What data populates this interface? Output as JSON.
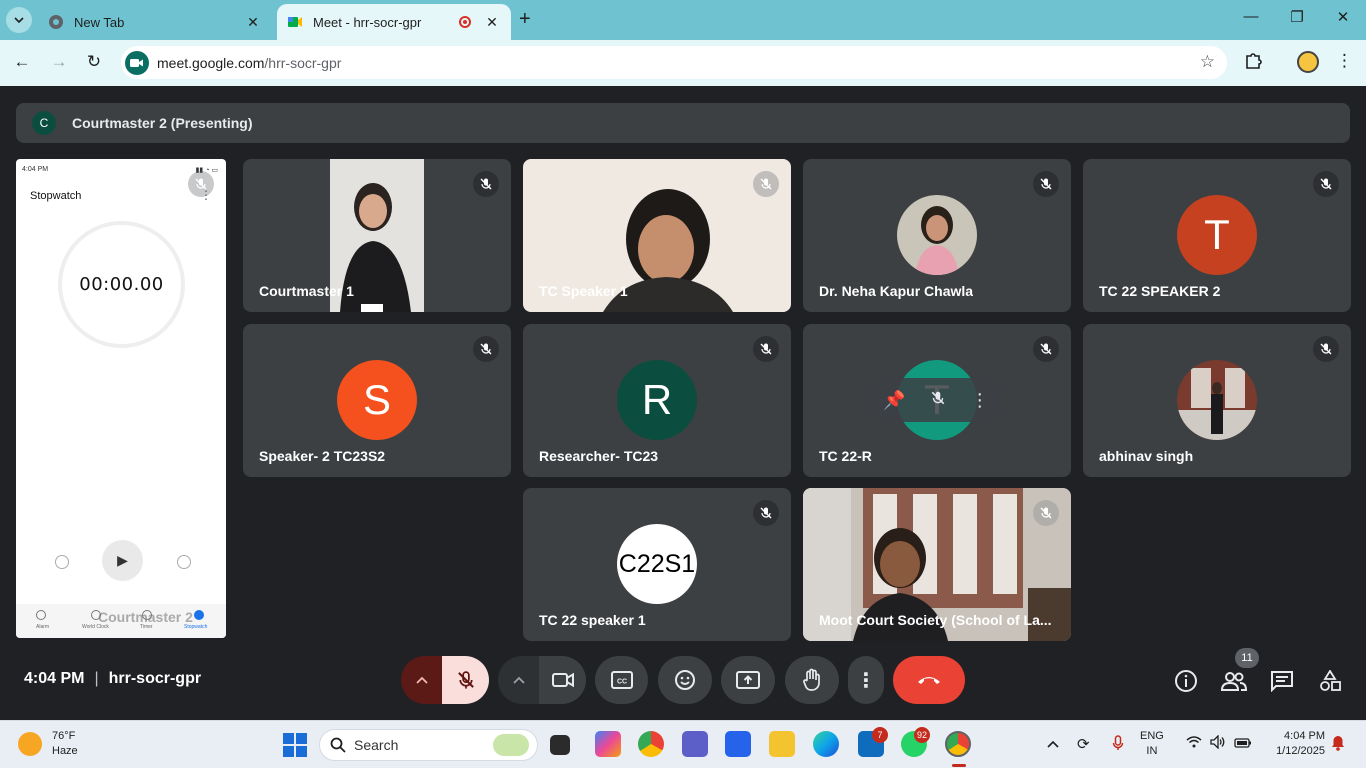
{
  "browser": {
    "tabs": [
      {
        "title": "New Tab",
        "active": false
      },
      {
        "title": "Meet - hrr-socr-gpr",
        "active": true,
        "recording": true
      }
    ],
    "url_domain": "meet.google.com",
    "url_path": "/hrr-socr-gpr"
  },
  "meet": {
    "presenting": {
      "avatar_letter": "C",
      "label": "Courtmaster 2 (Presenting)"
    },
    "shared_screen": {
      "status_time": "4:04 PM",
      "app_title": "Stopwatch",
      "timer": "00:00.00",
      "nav_items": [
        "Alarm",
        "World Clock",
        "Timer",
        "Stopwatch"
      ],
      "overlay_name": "Courtmaster 2"
    },
    "participants": [
      {
        "name": "Courtmaster 1",
        "type": "video"
      },
      {
        "name": "TC Speaker 1",
        "type": "video"
      },
      {
        "name": "Dr. Neha Kapur Chawla",
        "type": "photo"
      },
      {
        "name": "TC 22 SPEAKER 2",
        "type": "letter",
        "letter": "T",
        "color": "#c5411f"
      },
      {
        "name": "Speaker- 2 TC23S2",
        "type": "letter",
        "letter": "S",
        "color": "#f4511e"
      },
      {
        "name": "Researcher- TC23",
        "type": "letter",
        "letter": "R",
        "color": "#0b4d3e"
      },
      {
        "name": "TC 22-R",
        "type": "letter",
        "letter": "T",
        "color": "#129a7f"
      },
      {
        "name": "abhinav singh",
        "type": "photo"
      },
      {
        "name": "TC 22 speaker 1",
        "type": "letter",
        "letter": "C22S1",
        "color": "#ffffff"
      },
      {
        "name": "Moot Court Society (School of La...",
        "type": "video"
      }
    ],
    "bottom": {
      "time": "4:04 PM",
      "meeting_code": "hrr-socr-gpr",
      "participant_count": "11"
    }
  },
  "taskbar": {
    "weather_temp": "76°F",
    "weather_desc": "Haze",
    "search_label": "Search",
    "badges": {
      "office": "7",
      "whatsapp": "92"
    },
    "lang": "ENG",
    "region": "IN",
    "clock_time": "4:04 PM",
    "clock_date": "1/12/2025"
  },
  "colors": {
    "accent_meet": "#0b6e63",
    "leave": "#ea4335",
    "tab_bar": "#6fc3d0"
  }
}
